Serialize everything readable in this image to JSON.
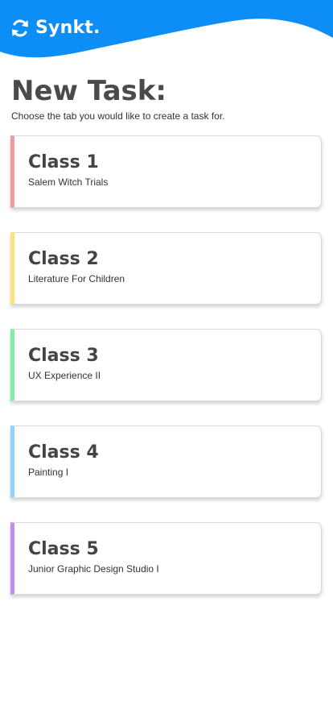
{
  "header": {
    "brand": "Synkt.",
    "logo_icon": "sync-icon",
    "background_color": "#0d8ef7"
  },
  "page": {
    "title": "New Task:",
    "subtitle": "Choose the tab you would like to create a task for."
  },
  "classes": [
    {
      "title": "Class 1",
      "subtitle": "Salem Witch Trials",
      "accent_color": "#f49a9a"
    },
    {
      "title": "Class 2",
      "subtitle": "Literature For Children",
      "accent_color": "#fbe27a"
    },
    {
      "title": "Class 3",
      "subtitle": "UX Experience II",
      "accent_color": "#7ef0a6"
    },
    {
      "title": "Class 4",
      "subtitle": "Painting I",
      "accent_color": "#8fd1ff"
    },
    {
      "title": "Class 5",
      "subtitle": "Junior Graphic Design Studio I",
      "accent_color": "#c28cf7"
    }
  ]
}
